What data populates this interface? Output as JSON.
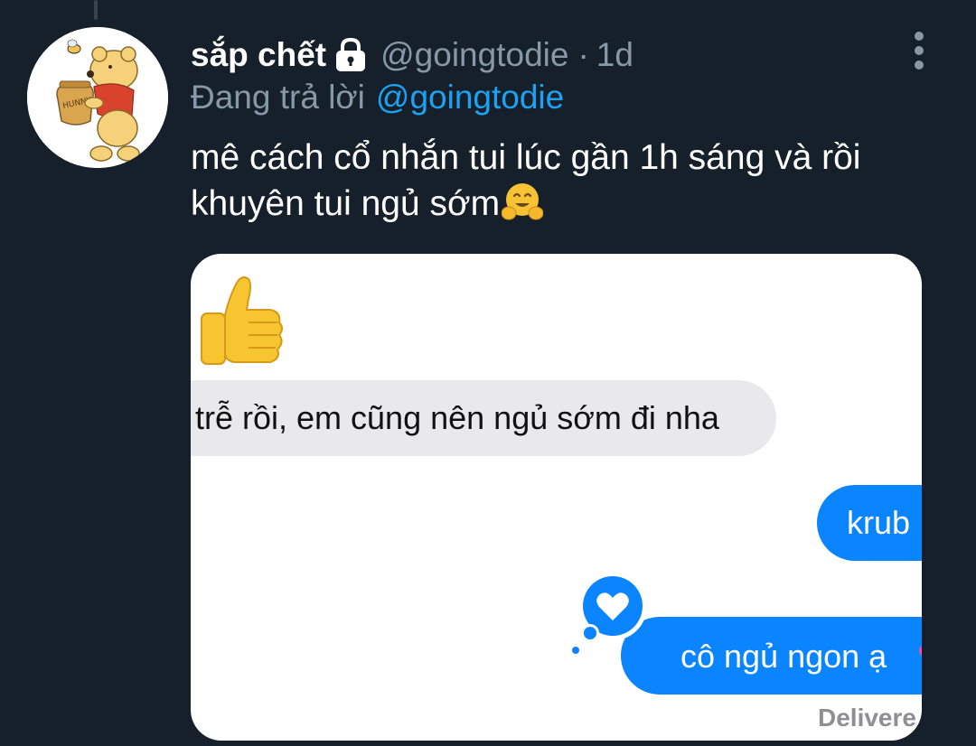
{
  "tweet": {
    "display_name": "sắp chết",
    "lock_icon": "lock-icon",
    "handle": "@goingtodie",
    "separator": "·",
    "timestamp": "1d",
    "more_icon": "more-vertical-icon",
    "reply_prefix": "Đang trả lời",
    "reply_mention": "@goingtodie",
    "text_line_1": "mê cách cổ nhắn tui lúc gần 1h sáng và rồi",
    "text_line_2": "khuyên tui ngủ sớm",
    "text_emoji": "hugging-face-emoji"
  },
  "media": {
    "top_emoji": "thumbs-up-emoji",
    "received_message": "trễ rồi, em cũng nên ngủ sớm đi nha",
    "sent_message_1": "krub",
    "sent_message_2": "cô ngủ ngon ạ",
    "sent_message_2_emoji": "two-hearts-emoji",
    "tapback_icon": "heart-icon",
    "delivered_label": "Delivere"
  },
  "colors": {
    "background": "#15202b",
    "secondary_text": "#8899a6",
    "link": "#1da1f2",
    "imessage_blue": "#0a84ff",
    "received_bubble": "#e9e9eb"
  }
}
